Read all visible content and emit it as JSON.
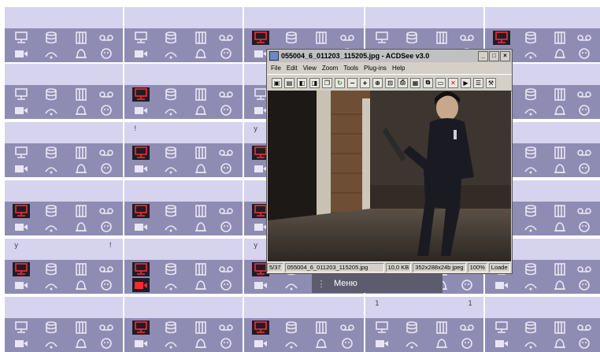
{
  "grid": {
    "rows": 6,
    "cols": 5,
    "cells": [
      [
        {
          "alarm": false
        },
        {
          "alarm": false
        },
        {
          "alarm": true,
          "sel": "green"
        },
        {
          "alarm": false
        },
        {
          "alarm": true
        }
      ],
      [
        {
          "alarm": false
        },
        {
          "alarm": true,
          "sel": "red"
        },
        {
          "alarm": false
        },
        {
          "alarm": false
        },
        {
          "alarm": false
        }
      ],
      [
        {
          "alarm": false
        },
        {
          "alarm": true,
          "markL": "!"
        },
        {
          "alarm": true,
          "markL": "y"
        },
        {
          "alarm": false
        },
        {
          "alarm": false
        }
      ],
      [
        {
          "alarm": true
        },
        {
          "alarm": true
        },
        {
          "alarm": true
        },
        {
          "alarm": false
        },
        {
          "alarm": false
        }
      ],
      [
        {
          "alarm": true,
          "markL": "y",
          "markR": "!"
        },
        {
          "alarm": true,
          "redcam": true
        },
        {
          "alarm": true,
          "markL": "y"
        },
        {
          "alarm": false
        },
        {
          "alarm": false
        }
      ],
      [
        {
          "alarm": false
        },
        {
          "alarm": true
        },
        {
          "alarm": true
        },
        {
          "alarm": false,
          "markL": "1",
          "markR": "1"
        },
        {
          "alarm": false
        }
      ]
    ]
  },
  "menu": {
    "label": "Меню"
  },
  "viewer": {
    "title": "055004_6_011203_115205.jpg - ACDSee v3.0",
    "menus": [
      "File",
      "Edit",
      "View",
      "Zoom",
      "Tools",
      "Plug-ins",
      "Help"
    ],
    "toolbar": [
      "browse",
      "open",
      "prev",
      "next",
      "copy",
      "refresh",
      "zoom-out",
      "zoom-in",
      "zoom-full",
      "fit",
      "print",
      "wallpaper",
      "copy2",
      "paste",
      "delete",
      "slideshow",
      "properties",
      "tools"
    ],
    "status": {
      "index": "5/37",
      "filename": "055004_6_011203_115205.jpg",
      "size": "10,0 KB",
      "dims": "352x288x24b jpeg",
      "zoom": "100%",
      "state": "Loade"
    }
  },
  "colors": {
    "alarm": "#ff2a2a",
    "tile_top": "#d6d3ee",
    "tile_bottom": "#8f8cb3",
    "select_red": "#e05050",
    "select_green": "#7fd040"
  }
}
